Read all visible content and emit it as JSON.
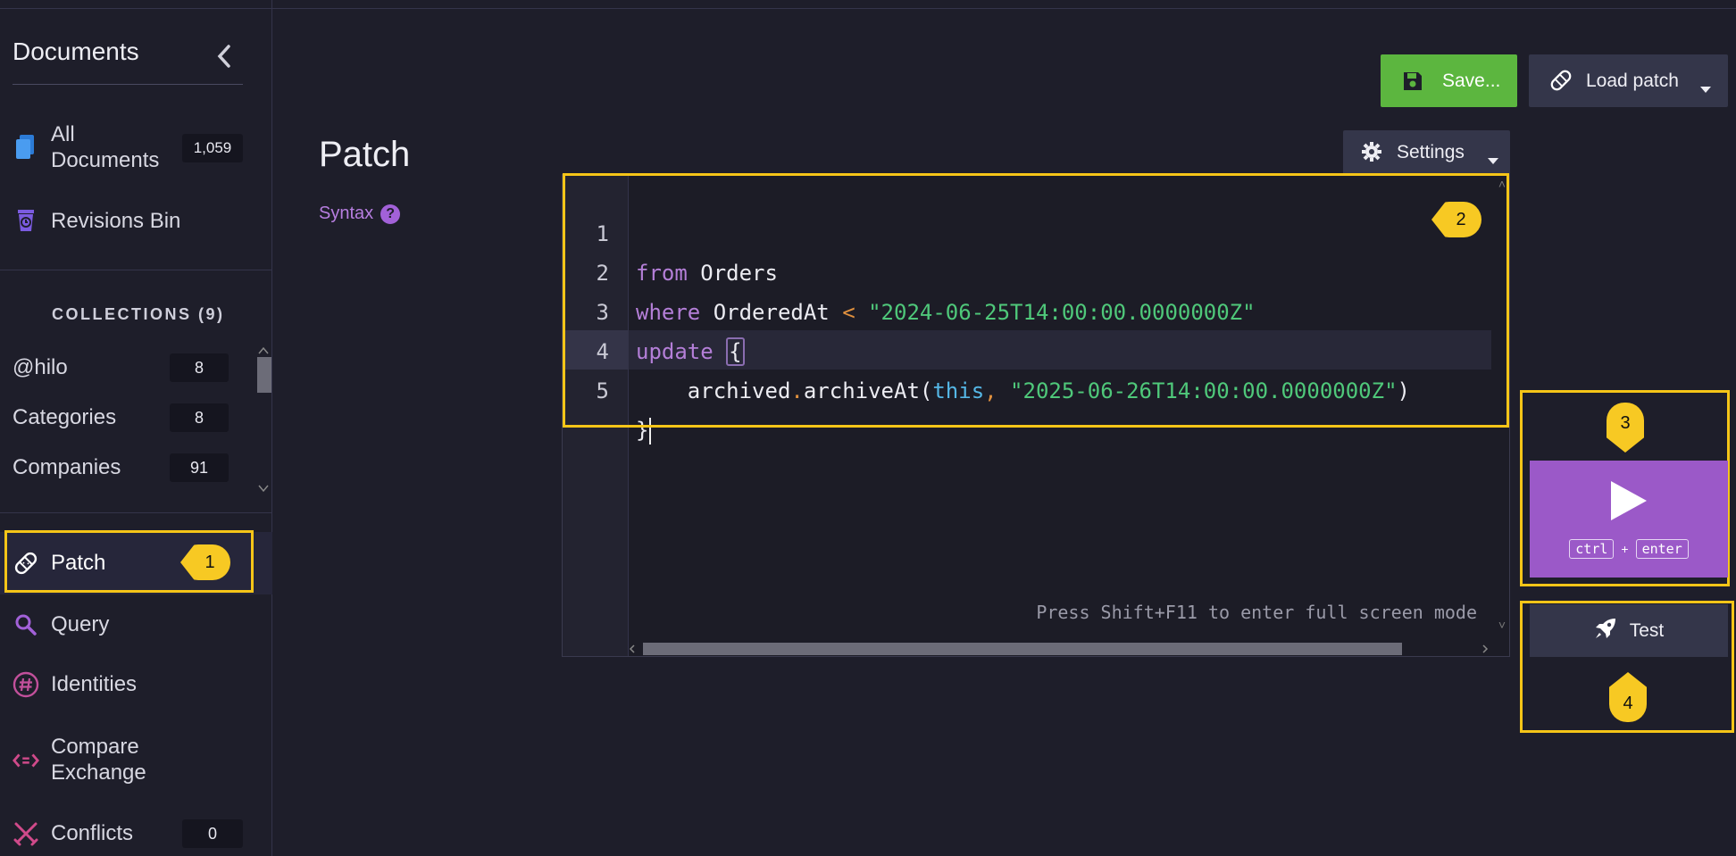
{
  "sidebar": {
    "title": "Documents",
    "all_documents": {
      "label": "All Documents",
      "label_line1": "All",
      "label_line2": "Documents",
      "count": "1,059"
    },
    "revisions_bin": {
      "label": "Revisions Bin"
    },
    "collections_header": "COLLECTIONS (9)",
    "collections": [
      {
        "name": "@hilo",
        "count": "8"
      },
      {
        "name": "Categories",
        "count": "8"
      },
      {
        "name": "Companies",
        "count": "91"
      }
    ],
    "nav": [
      {
        "label": "Patch",
        "icon": "bandage-icon",
        "active": true
      },
      {
        "label": "Query",
        "icon": "search-icon"
      },
      {
        "label": "Identities",
        "icon": "hash-icon"
      },
      {
        "label": "Compare Exchange",
        "label_line1": "Compare",
        "label_line2": "Exchange",
        "icon": "compare-exchange-icon"
      },
      {
        "label": "Conflicts",
        "icon": "swords-icon",
        "count": "0"
      }
    ]
  },
  "toolbar": {
    "save_label": "Save...",
    "load_patch_label": "Load patch"
  },
  "page": {
    "title": "Patch",
    "syntax_label": "Syntax",
    "syntax_help": "?"
  },
  "editor": {
    "settings_label": "Settings",
    "line_numbers": [
      "1",
      "2",
      "3",
      "4",
      "5"
    ],
    "lines": [
      {
        "kw": "from",
        "rest": " Orders"
      },
      {
        "kw": "where",
        "ident": " OrderedAt ",
        "op": "<",
        "str": " \"2024-06-25T14:00:00.0000000Z\""
      },
      {
        "kw": "update",
        "brace": "{"
      },
      {
        "indent": "    ",
        "obj": "archived",
        "dot": ".",
        "fn": "archiveAt(",
        "this": "this",
        "comma": ",",
        "str": " \"2025-06-26T14:00:00.0000000Z\"",
        "close": ")"
      },
      {
        "brace": "}"
      }
    ],
    "fullscreen_hint": "Press Shift+F11 to enter full screen mode"
  },
  "run": {
    "kbd_ctrl": "ctrl",
    "plus": "+",
    "kbd_enter": "enter",
    "test_label": "Test"
  },
  "callouts": [
    "1",
    "2",
    "3",
    "4"
  ],
  "colors": {
    "accent_purple": "#9b59c8",
    "save_green": "#5cb63f",
    "highlight_yellow": "#f5c518"
  }
}
